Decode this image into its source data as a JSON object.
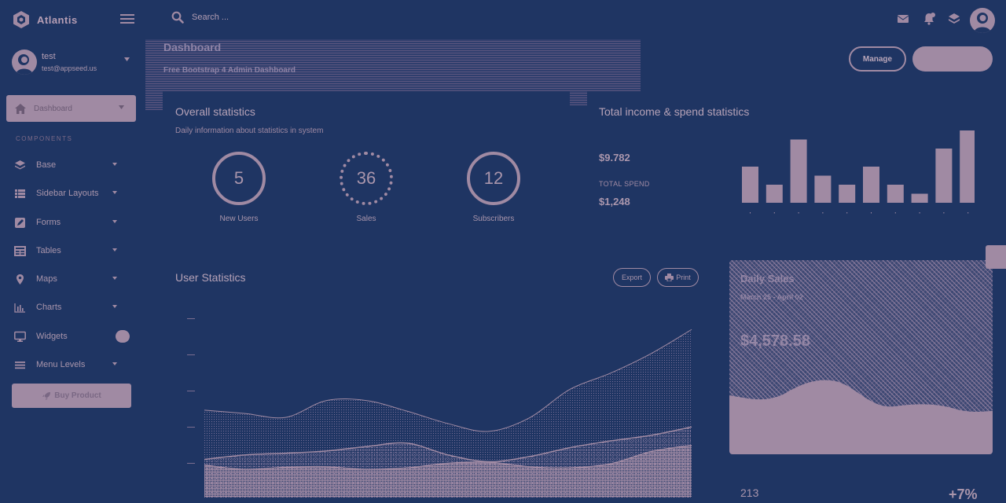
{
  "brand": {
    "name": "Atlantis"
  },
  "user": {
    "name": "test",
    "email": "test@appseed.us"
  },
  "sidebar": {
    "active_item": "Dashboard",
    "section_title": "COMPONENTS",
    "items": [
      {
        "label": "Base",
        "icon": "layers-icon"
      },
      {
        "label": "Sidebar Layouts",
        "icon": "th-list-icon"
      },
      {
        "label": "Forms",
        "icon": "pen-square-icon"
      },
      {
        "label": "Tables",
        "icon": "table-icon"
      },
      {
        "label": "Maps",
        "icon": "map-marker-icon"
      },
      {
        "label": "Charts",
        "icon": "bar-chart-icon"
      },
      {
        "label": "Widgets",
        "icon": "desktop-icon"
      },
      {
        "label": "Menu Levels",
        "icon": "bars-icon"
      }
    ],
    "buy_button": "Buy Product"
  },
  "search": {
    "placeholder": "Search ..."
  },
  "header": {
    "title": "Dashboard",
    "subtitle": "Free Bootstrap 4 Admin Dashboard",
    "manage_button": "Manage"
  },
  "overall": {
    "title": "Overall statistics",
    "subtitle": "Daily information about statistics in system",
    "stats": [
      {
        "value": "5",
        "label": "New Users"
      },
      {
        "value": "36",
        "label": "Sales"
      },
      {
        "value": "12",
        "label": "Subscribers"
      }
    ]
  },
  "income": {
    "title": "Total income & spend statistics",
    "income_value": "$9.782",
    "spend_label": "TOTAL SPEND",
    "spend_value": "$1,248"
  },
  "user_stats": {
    "title": "User Statistics",
    "export_button": "Export",
    "print_button": "Print"
  },
  "daily_sales": {
    "title": "Daily Sales",
    "date_range": "March 25 - April 02",
    "value": "$4,578.58"
  },
  "bottom": {
    "count": "213",
    "change": "+7%"
  },
  "colors": {
    "background": "#1f3563",
    "accent": "#a08aa3"
  },
  "chart_data": [
    {
      "type": "bar",
      "values": [
        4,
        2,
        7,
        3,
        2,
        4,
        2,
        1,
        6,
        8
      ],
      "ylim": [
        0,
        8
      ]
    },
    {
      "type": "area",
      "series": [
        {
          "values": [
            156,
            150,
            143,
            173,
            173,
            154,
            132,
            118,
            142,
            193,
            222,
            257,
            300
          ]
        },
        {
          "values": [
            68,
            76,
            79,
            83,
            91,
            97,
            76,
            64,
            73,
            89,
            101,
            111,
            126
          ]
        },
        {
          "values": [
            58,
            50,
            54,
            55,
            50,
            53,
            61,
            63,
            55,
            53,
            60,
            82,
            93
          ]
        }
      ]
    }
  ]
}
